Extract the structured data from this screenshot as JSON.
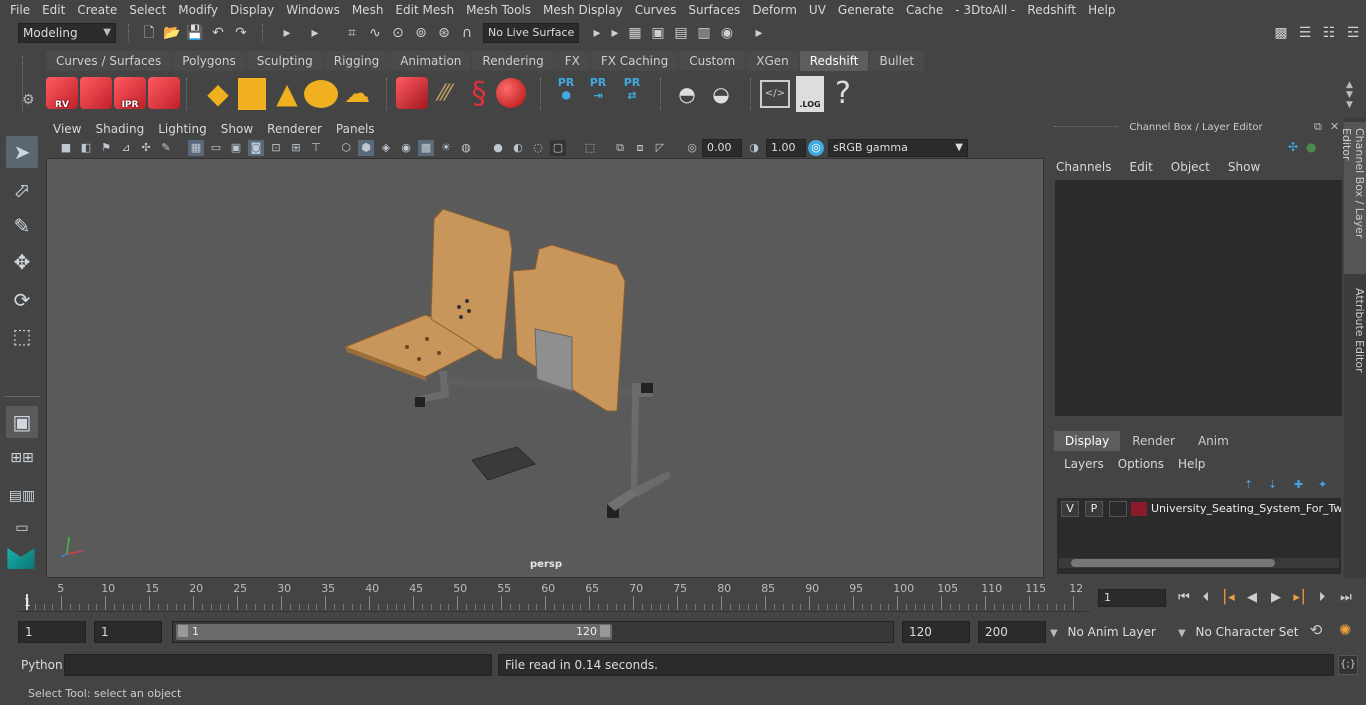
{
  "menubar": [
    "File",
    "Edit",
    "Create",
    "Select",
    "Modify",
    "Display",
    "Windows",
    "Mesh",
    "Edit Mesh",
    "Mesh Tools",
    "Mesh Display",
    "Curves",
    "Surfaces",
    "Deform",
    "UV",
    "Generate",
    "Cache",
    "- 3DtoAll -",
    "Redshift",
    "Help"
  ],
  "statusline": {
    "mode": "Modeling",
    "live_surface": "No Live Surface"
  },
  "shelf": {
    "tabs": [
      "Curves / Surfaces",
      "Polygons",
      "Sculpting",
      "Rigging",
      "Animation",
      "Rendering",
      "FX",
      "FX Caching",
      "Custom",
      "XGen",
      "Redshift",
      "Bullet"
    ],
    "active_tab": "Redshift",
    "icons": [
      {
        "name": "rv-cube-icon",
        "label": "RV"
      },
      {
        "name": "render-sequence-cube-icon",
        "label": ""
      },
      {
        "name": "ipr-cube-icon",
        "label": "IPR"
      },
      {
        "name": "render-settings-cube-icon",
        "label": ""
      },
      {
        "name": "pr-icon-1",
        "label": "PR"
      },
      {
        "name": "pr-icon-2",
        "label": "PR"
      },
      {
        "name": "pr-icon-3",
        "label": "PR"
      },
      {
        "name": "log-icon",
        "label": ".LOG"
      },
      {
        "name": "help-icon",
        "label": "?"
      }
    ]
  },
  "viewport": {
    "menu": [
      "View",
      "Shading",
      "Lighting",
      "Show",
      "Renderer",
      "Panels"
    ],
    "exposure": "0.00",
    "gamma": "1.00",
    "color_space": "sRGB gamma",
    "camera": "persp"
  },
  "channel_box": {
    "title": "Channel Box / Layer Editor",
    "menu": [
      "Channels",
      "Edit",
      "Object",
      "Show"
    ],
    "layer_tabs": [
      "Display",
      "Render",
      "Anim"
    ],
    "active_layer_tab": "Display",
    "layer_menu": [
      "Layers",
      "Options",
      "Help"
    ],
    "layer": {
      "v": "V",
      "p": "P",
      "name": "University_Seating_System_For_Two_",
      "color": "#8b1a2c"
    }
  },
  "side_tabs": [
    "Channel Box / Layer Editor",
    "Attribute Editor"
  ],
  "timeline": {
    "ticks": [
      "5",
      "10",
      "15",
      "20",
      "25",
      "30",
      "35",
      "40",
      "45",
      "50",
      "55",
      "60",
      "65",
      "70",
      "75",
      "80",
      "85",
      "90",
      "95",
      "100",
      "105",
      "110",
      "115",
      "12"
    ],
    "current_frame": "1",
    "start_marker": "1"
  },
  "range": {
    "start": "1",
    "playback_start": "1",
    "slider_start": "1",
    "slider_end": "120",
    "playback_end": "120",
    "end": "200",
    "anim_layer": "No Anim Layer",
    "character_set": "No Character Set"
  },
  "commandline": {
    "language": "Python",
    "result": "File read in  0.14 seconds."
  },
  "helpline": "Select Tool: select an object",
  "colors": {
    "wood": "#c8955a",
    "metal": "#6b6b6b",
    "viewport_bg": "#5a5a5a",
    "accent_blue": "#3fa9e0",
    "redshift_red": "#e0303a"
  }
}
